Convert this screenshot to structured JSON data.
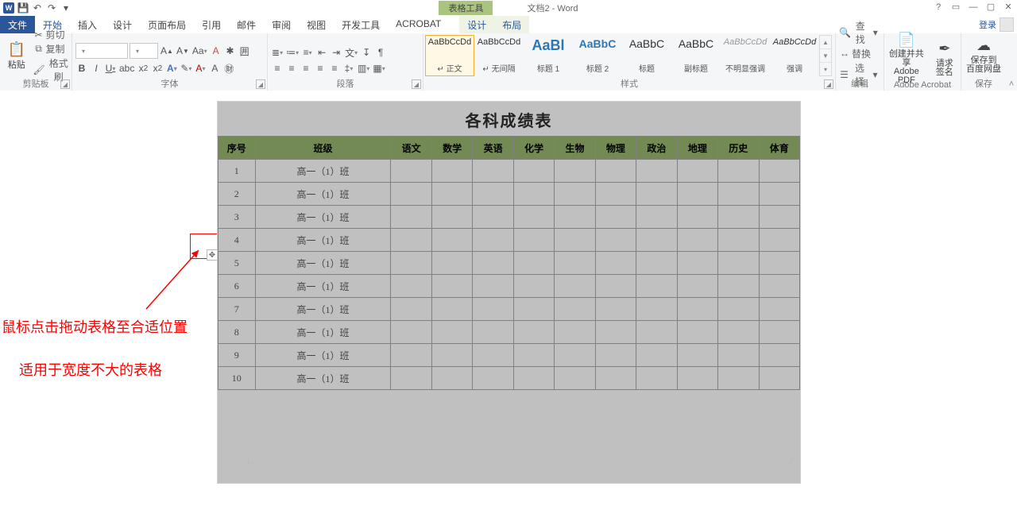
{
  "titlebar": {
    "app_icon_text": "W",
    "table_tools_label": "表格工具",
    "doc_title": "文档2 - Word",
    "qat_icons": [
      "save-icon",
      "undo-icon",
      "redo-icon",
      "dropdown-icon"
    ]
  },
  "tabs": {
    "file": "文件",
    "home": "开始",
    "insert": "插入",
    "design": "设计",
    "page_layout": "页面布局",
    "references": "引用",
    "mailings": "邮件",
    "review": "审阅",
    "view": "视图",
    "developer": "开发工具",
    "acrobat": "ACROBAT",
    "ctx_design": "设计",
    "ctx_layout": "布局",
    "login": "登录"
  },
  "ribbon": {
    "clipboard": {
      "label": "剪贴板",
      "paste": "粘贴",
      "cut": "剪切",
      "copy": "复制",
      "format_painter": "格式刷"
    },
    "font": {
      "label": "字体",
      "font_family": "",
      "font_size": ""
    },
    "paragraph": {
      "label": "段落"
    },
    "styles": {
      "label": "样式",
      "items": [
        {
          "preview": "AaBbCcDd",
          "name": "↵ 正文",
          "size": "11px"
        },
        {
          "preview": "AaBbCcDd",
          "name": "↵ 无间隔",
          "size": "11px"
        },
        {
          "preview": "AaBl",
          "name": "标题 1",
          "size": "18px",
          "bold": true,
          "blue": true
        },
        {
          "preview": "AaBbC",
          "name": "标题 2",
          "size": "14px",
          "bold": true,
          "blue": true
        },
        {
          "preview": "AaBbC",
          "name": "标题",
          "size": "14px"
        },
        {
          "preview": "AaBbC",
          "name": "副标题",
          "size": "14px"
        },
        {
          "preview": "AaBbCcDd",
          "name": "不明显强调",
          "size": "11px",
          "italic": true,
          "gray": true
        },
        {
          "preview": "AaBbCcDd",
          "name": "强调",
          "size": "11px",
          "italic": true
        }
      ]
    },
    "editing": {
      "label": "编辑",
      "find": "查找",
      "replace": "替换",
      "select": "选择"
    },
    "acrobat": {
      "label": "Adobe Acrobat",
      "create": "创建并共享\nAdobe PDF",
      "sign": "请求\n签名"
    },
    "save": {
      "label": "保存",
      "save_to": "保存到\n百度网盘"
    }
  },
  "document": {
    "title": "各科成绩表",
    "headers": [
      "序号",
      "班级",
      "语文",
      "数学",
      "英语",
      "化学",
      "生物",
      "物理",
      "政治",
      "地理",
      "历史",
      "体育"
    ],
    "rows": [
      {
        "idx": "1",
        "class": "高一（1）班"
      },
      {
        "idx": "2",
        "class": "高一（1）班"
      },
      {
        "idx": "3",
        "class": "高一（1）班"
      },
      {
        "idx": "4",
        "class": "高一（1）班"
      },
      {
        "idx": "5",
        "class": "高一（1）班"
      },
      {
        "idx": "6",
        "class": "高一（1）班"
      },
      {
        "idx": "7",
        "class": "高一（1）班"
      },
      {
        "idx": "8",
        "class": "高一（1）班"
      },
      {
        "idx": "9",
        "class": "高一（1）班"
      },
      {
        "idx": "10",
        "class": "高一（1）班"
      }
    ]
  },
  "annotations": {
    "line1": "鼠标点击拖动表格至合适位置",
    "line2": "适用于宽度不大的表格",
    "move_handle_glyph": "✥"
  }
}
